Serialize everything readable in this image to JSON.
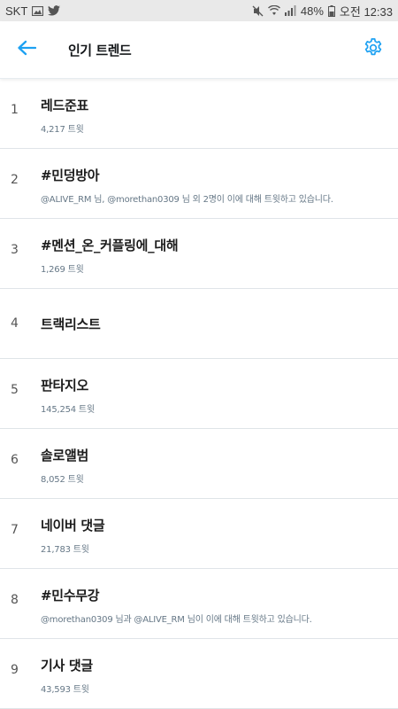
{
  "status": {
    "carrier": "SKT",
    "battery": "48%",
    "time": "오전 12:33"
  },
  "header": {
    "title": "인기 트렌드"
  },
  "trends": [
    {
      "rank": "1",
      "name": "레드준표",
      "meta": "4,217 트윗"
    },
    {
      "rank": "2",
      "name": "#민덩방아",
      "meta": "@ALIVE_RM 님, @morethan0309 님 외 2명이 이에 대해 트윗하고 있습니다."
    },
    {
      "rank": "3",
      "name": "#멘션_온_커플링에_대해",
      "meta": "1,269 트윗"
    },
    {
      "rank": "4",
      "name": "트랙리스트",
      "meta": ""
    },
    {
      "rank": "5",
      "name": "판타지오",
      "meta": "145,254 트윗"
    },
    {
      "rank": "6",
      "name": "솔로앨범",
      "meta": "8,052 트윗"
    },
    {
      "rank": "7",
      "name": "네이버 댓글",
      "meta": "21,783 트윗"
    },
    {
      "rank": "8",
      "name": "#민수무강",
      "meta": "@morethan0309 님과 @ALIVE_RM 님이 이에 대해 트윗하고 있습니다."
    },
    {
      "rank": "9",
      "name": "기사 댓글",
      "meta": "43,593 트윗"
    }
  ],
  "colors": {
    "accent": "#1da1f2",
    "divider": "#dfe4e8",
    "meta": "#657786"
  },
  "icons": [
    "image-icon",
    "twitter-icon",
    "mute-icon",
    "wifi-icon",
    "signal-icon",
    "battery-icon",
    "back-arrow-icon",
    "gear-icon"
  ]
}
